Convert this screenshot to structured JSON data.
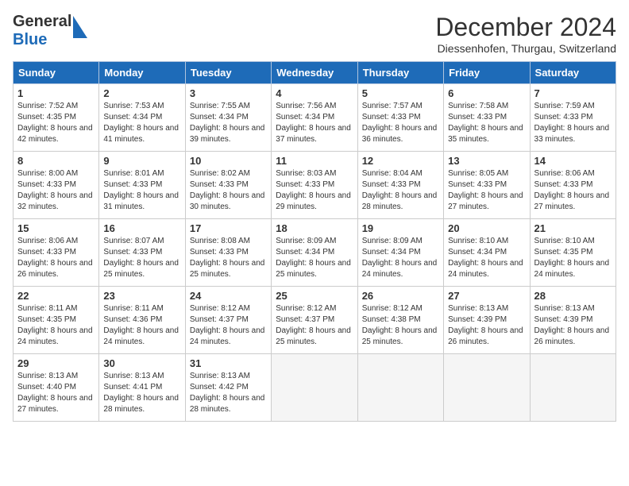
{
  "header": {
    "logo_general": "General",
    "logo_blue": "Blue",
    "month_title": "December 2024",
    "location": "Diessenhofen, Thurgau, Switzerland"
  },
  "weekdays": [
    "Sunday",
    "Monday",
    "Tuesday",
    "Wednesday",
    "Thursday",
    "Friday",
    "Saturday"
  ],
  "weeks": [
    [
      {
        "day": "1",
        "sunrise": "7:52 AM",
        "sunset": "4:35 PM",
        "daylight": "8 hours and 42 minutes."
      },
      {
        "day": "2",
        "sunrise": "7:53 AM",
        "sunset": "4:34 PM",
        "daylight": "8 hours and 41 minutes."
      },
      {
        "day": "3",
        "sunrise": "7:55 AM",
        "sunset": "4:34 PM",
        "daylight": "8 hours and 39 minutes."
      },
      {
        "day": "4",
        "sunrise": "7:56 AM",
        "sunset": "4:34 PM",
        "daylight": "8 hours and 37 minutes."
      },
      {
        "day": "5",
        "sunrise": "7:57 AM",
        "sunset": "4:33 PM",
        "daylight": "8 hours and 36 minutes."
      },
      {
        "day": "6",
        "sunrise": "7:58 AM",
        "sunset": "4:33 PM",
        "daylight": "8 hours and 35 minutes."
      },
      {
        "day": "7",
        "sunrise": "7:59 AM",
        "sunset": "4:33 PM",
        "daylight": "8 hours and 33 minutes."
      }
    ],
    [
      {
        "day": "8",
        "sunrise": "8:00 AM",
        "sunset": "4:33 PM",
        "daylight": "8 hours and 32 minutes."
      },
      {
        "day": "9",
        "sunrise": "8:01 AM",
        "sunset": "4:33 PM",
        "daylight": "8 hours and 31 minutes."
      },
      {
        "day": "10",
        "sunrise": "8:02 AM",
        "sunset": "4:33 PM",
        "daylight": "8 hours and 30 minutes."
      },
      {
        "day": "11",
        "sunrise": "8:03 AM",
        "sunset": "4:33 PM",
        "daylight": "8 hours and 29 minutes."
      },
      {
        "day": "12",
        "sunrise": "8:04 AM",
        "sunset": "4:33 PM",
        "daylight": "8 hours and 28 minutes."
      },
      {
        "day": "13",
        "sunrise": "8:05 AM",
        "sunset": "4:33 PM",
        "daylight": "8 hours and 27 minutes."
      },
      {
        "day": "14",
        "sunrise": "8:06 AM",
        "sunset": "4:33 PM",
        "daylight": "8 hours and 27 minutes."
      }
    ],
    [
      {
        "day": "15",
        "sunrise": "8:06 AM",
        "sunset": "4:33 PM",
        "daylight": "8 hours and 26 minutes."
      },
      {
        "day": "16",
        "sunrise": "8:07 AM",
        "sunset": "4:33 PM",
        "daylight": "8 hours and 25 minutes."
      },
      {
        "day": "17",
        "sunrise": "8:08 AM",
        "sunset": "4:33 PM",
        "daylight": "8 hours and 25 minutes."
      },
      {
        "day": "18",
        "sunrise": "8:09 AM",
        "sunset": "4:34 PM",
        "daylight": "8 hours and 25 minutes."
      },
      {
        "day": "19",
        "sunrise": "8:09 AM",
        "sunset": "4:34 PM",
        "daylight": "8 hours and 24 minutes."
      },
      {
        "day": "20",
        "sunrise": "8:10 AM",
        "sunset": "4:34 PM",
        "daylight": "8 hours and 24 minutes."
      },
      {
        "day": "21",
        "sunrise": "8:10 AM",
        "sunset": "4:35 PM",
        "daylight": "8 hours and 24 minutes."
      }
    ],
    [
      {
        "day": "22",
        "sunrise": "8:11 AM",
        "sunset": "4:35 PM",
        "daylight": "8 hours and 24 minutes."
      },
      {
        "day": "23",
        "sunrise": "8:11 AM",
        "sunset": "4:36 PM",
        "daylight": "8 hours and 24 minutes."
      },
      {
        "day": "24",
        "sunrise": "8:12 AM",
        "sunset": "4:37 PM",
        "daylight": "8 hours and 24 minutes."
      },
      {
        "day": "25",
        "sunrise": "8:12 AM",
        "sunset": "4:37 PM",
        "daylight": "8 hours and 25 minutes."
      },
      {
        "day": "26",
        "sunrise": "8:12 AM",
        "sunset": "4:38 PM",
        "daylight": "8 hours and 25 minutes."
      },
      {
        "day": "27",
        "sunrise": "8:13 AM",
        "sunset": "4:39 PM",
        "daylight": "8 hours and 26 minutes."
      },
      {
        "day": "28",
        "sunrise": "8:13 AM",
        "sunset": "4:39 PM",
        "daylight": "8 hours and 26 minutes."
      }
    ],
    [
      {
        "day": "29",
        "sunrise": "8:13 AM",
        "sunset": "4:40 PM",
        "daylight": "8 hours and 27 minutes."
      },
      {
        "day": "30",
        "sunrise": "8:13 AM",
        "sunset": "4:41 PM",
        "daylight": "8 hours and 28 minutes."
      },
      {
        "day": "31",
        "sunrise": "8:13 AM",
        "sunset": "4:42 PM",
        "daylight": "8 hours and 28 minutes."
      },
      null,
      null,
      null,
      null
    ]
  ]
}
